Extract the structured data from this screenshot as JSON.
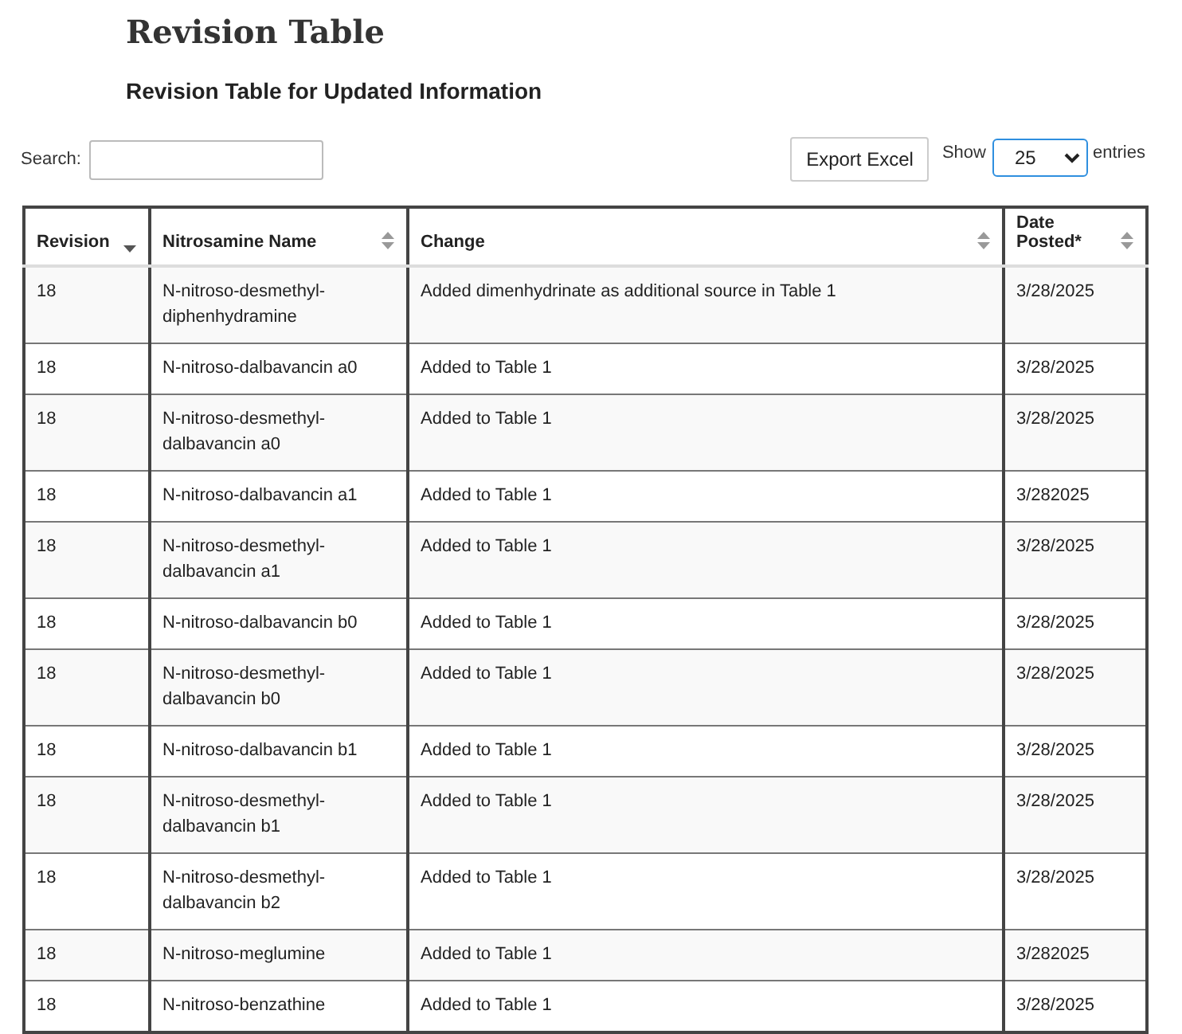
{
  "title": "Revision Table",
  "subtitle": "Revision Table for Updated Information",
  "search": {
    "label": "Search:"
  },
  "export_button": "Export Excel",
  "length": {
    "before": "Show",
    "value": "25",
    "after": "entries"
  },
  "table": {
    "columns": [
      {
        "label": "Revision",
        "sorted": true
      },
      {
        "label": "Nitrosamine Name",
        "sorted": false
      },
      {
        "label": "Change",
        "sorted": false
      },
      {
        "label": "Date Posted*",
        "sorted": false
      }
    ],
    "rows": [
      [
        "18",
        "N-nitroso-desmethyl-diphenhydramine",
        "Added dimenhydrinate as additional source in Table 1",
        "3/28/2025"
      ],
      [
        "18",
        "N-nitroso-dalbavancin a0",
        "Added to Table 1",
        "3/28/2025"
      ],
      [
        "18",
        "N-nitroso-desmethyl-dalbavancin a0",
        "Added to Table 1",
        "3/28/2025"
      ],
      [
        "18",
        "N-nitroso-dalbavancin a1",
        "Added to Table 1",
        "3/282025"
      ],
      [
        "18",
        "N-nitroso-desmethyl-dalbavancin a1",
        "Added to Table 1",
        "3/28/2025"
      ],
      [
        "18",
        "N-nitroso-dalbavancin b0",
        "Added to Table 1",
        "3/28/2025"
      ],
      [
        "18",
        "N-nitroso-desmethyl-dalbavancin b0",
        "Added to Table 1",
        "3/28/2025"
      ],
      [
        "18",
        "N-nitroso-dalbavancin b1",
        "Added to Table 1",
        "3/28/2025"
      ],
      [
        "18",
        "N-nitroso-desmethyl-dalbavancin b1",
        "Added to Table 1",
        "3/28/2025"
      ],
      [
        "18",
        "N-nitroso-desmethyl-dalbavancin b2",
        "Added to Table 1",
        "3/28/2025"
      ],
      [
        "18",
        "N-nitroso-meglumine",
        "Added to Table 1",
        "3/282025"
      ],
      [
        "18",
        "N-nitroso-benzathine",
        "Added to Table 1",
        "3/28/2025"
      ]
    ]
  }
}
